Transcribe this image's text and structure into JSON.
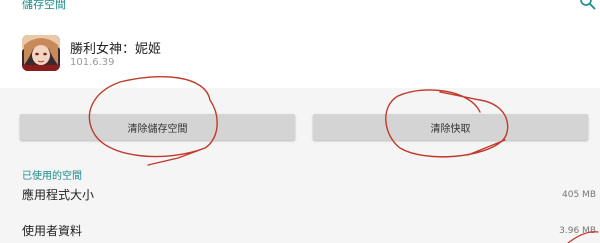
{
  "header": {
    "section_title": "儲存空間"
  },
  "app": {
    "name": "勝利女神：妮姬",
    "version": "101.6.39"
  },
  "actions": {
    "clear_storage_label": "清除儲存空間",
    "clear_cache_label": "清除快取"
  },
  "used_space": {
    "title": "已使用的空間",
    "rows": [
      {
        "label": "應用程式大小",
        "value": "405 MB"
      },
      {
        "label": "使用者資料",
        "value": "3.96 MB"
      }
    ]
  },
  "colors": {
    "accent": "#1a8a8a",
    "annotation": "#c0392b"
  }
}
